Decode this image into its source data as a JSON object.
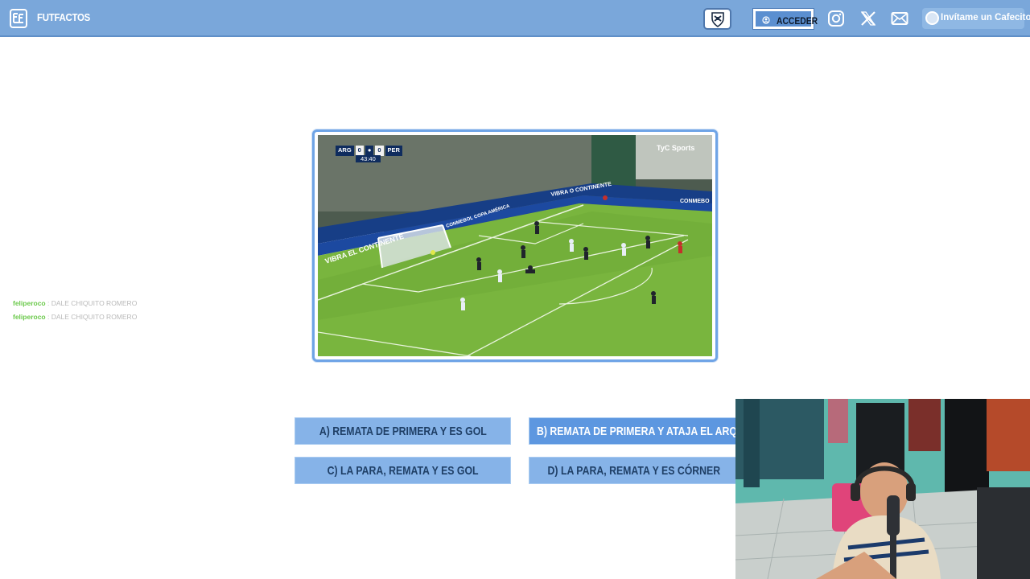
{
  "header": {
    "brand": "FUTFACTOS",
    "login_label": "ACCEDER",
    "coffee_label": "Invítame un Cafecito"
  },
  "video": {
    "home_team": "ARG",
    "home_score": "0",
    "away_score": "0",
    "away_team": "PER",
    "clock": "43:40",
    "broadcaster": "TyC Sports"
  },
  "chat": [
    {
      "user": "feliperoco",
      "message": ": DALE CHIQUITO ROMERO"
    },
    {
      "user": "feliperoco",
      "message": ": DALE CHIQUITO ROMERO"
    }
  ],
  "options": [
    {
      "label": "A) REMATA DE PRIMERA Y ES GOL"
    },
    {
      "label": "B) REMATA DE PRIMERA Y ATAJA EL ARQUERO"
    },
    {
      "label": "C) LA PARA, REMATA Y ES GOL"
    },
    {
      "label": "D) LA PARA, REMATA Y ES CÓRNER"
    }
  ],
  "colors": {
    "header_bg": "#7aa7da",
    "option_bg": "#86b3e8",
    "option_selected_bg": "#5d97e0",
    "frame_border": "#6fa4e6"
  }
}
